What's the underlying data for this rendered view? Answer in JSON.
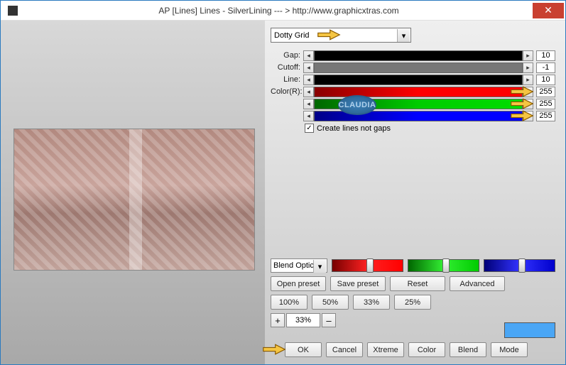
{
  "titlebar": {
    "title": "AP [Lines]  Lines - SilverLining    --- > http://www.graphicxtras.com"
  },
  "preset_dropdown": {
    "selected": "Dotty Grid"
  },
  "sliders": {
    "gap": {
      "label": "Gap:",
      "value": "10"
    },
    "cutoff": {
      "label": "Cutoff:",
      "value": "-1"
    },
    "line": {
      "label": "Line:",
      "value": "10"
    },
    "colorR": {
      "label": "Color(R):",
      "value": "255"
    },
    "colorG": {
      "label": "",
      "value": "255"
    },
    "colorB": {
      "label": "",
      "value": "255"
    }
  },
  "checkbox": {
    "label": "Create lines not gaps",
    "checked": true
  },
  "blend_dropdown": {
    "selected": "Blend Optic"
  },
  "buttons": {
    "open_preset": "Open preset",
    "save_preset": "Save preset",
    "reset": "Reset",
    "advanced": "Advanced",
    "z100": "100%",
    "z50": "50%",
    "z33": "33%",
    "z25": "25%",
    "plus": "+",
    "minus": "–",
    "ok": "OK",
    "cancel": "Cancel",
    "xtreme": "Xtreme",
    "color": "Color",
    "blend": "Blend",
    "mode": "Mode"
  },
  "zoom": {
    "value": "33%"
  },
  "stamp": "CLAUDIA"
}
